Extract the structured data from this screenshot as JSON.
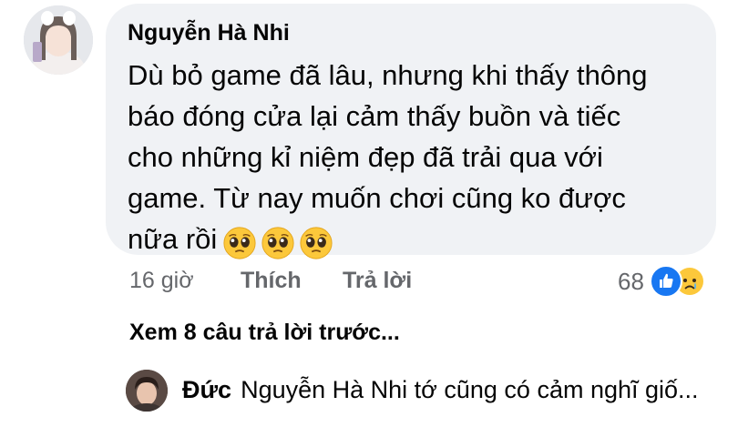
{
  "comment": {
    "author": "Nguyễn Hà Nhi",
    "text_lines": [
      "Dù bỏ game đã lâu, nhưng khi thấy thông",
      "báo đóng cửa lại cảm thấy buồn và tiếc",
      "cho những kỉ niệm đẹp đã trải qua với",
      "game. Từ nay muốn chơi cũng ko được",
      "nữa rồi"
    ],
    "emojis": [
      "pleading-face",
      "pleading-face",
      "pleading-face"
    ],
    "timestamp": "16 giờ",
    "like_label": "Thích",
    "reply_label": "Trả lời",
    "reaction_count": "68",
    "reaction_icons": [
      "like-icon",
      "sad-icon"
    ]
  },
  "view_previous_replies": "Xem 8 câu trả lời trước...",
  "reply": {
    "author": "Đức",
    "text": "Nguyễn Hà Nhi tớ cũng có cảm nghĩ giố..."
  },
  "colors": {
    "bubble_bg": "#f0f2f5",
    "meta_text": "#65676b",
    "like_blue": "#1877f2",
    "emoji_yellow": "#fcc83b"
  }
}
